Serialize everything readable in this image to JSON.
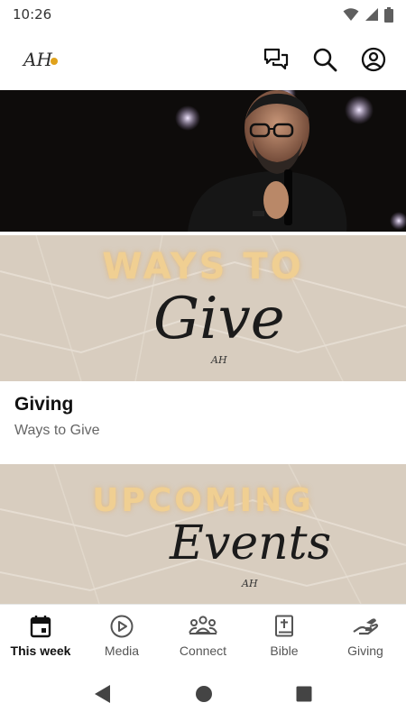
{
  "status_bar": {
    "time": "10:26"
  },
  "app_bar": {
    "logo_text": "AH"
  },
  "promos": [
    {
      "title": "WAYS TO",
      "script": "Give",
      "mark": "AH"
    },
    {
      "title": "UPCOMING",
      "script": "Events",
      "mark": "AH"
    }
  ],
  "cards": [
    {
      "title": "Giving",
      "subtitle": "Ways to Give"
    }
  ],
  "bottom_nav": [
    {
      "label": "This week",
      "icon": "calendar-icon",
      "active": true
    },
    {
      "label": "Media",
      "icon": "play-circle-icon",
      "active": false
    },
    {
      "label": "Connect",
      "icon": "group-icon",
      "active": false
    },
    {
      "label": "Bible",
      "icon": "bible-icon",
      "active": false
    },
    {
      "label": "Giving",
      "icon": "giving-hand-icon",
      "active": false
    }
  ],
  "colors": {
    "accent_gold": "#f0cf92",
    "paper": "#d8cdbf",
    "hero_bg": "#0e0c0b"
  }
}
